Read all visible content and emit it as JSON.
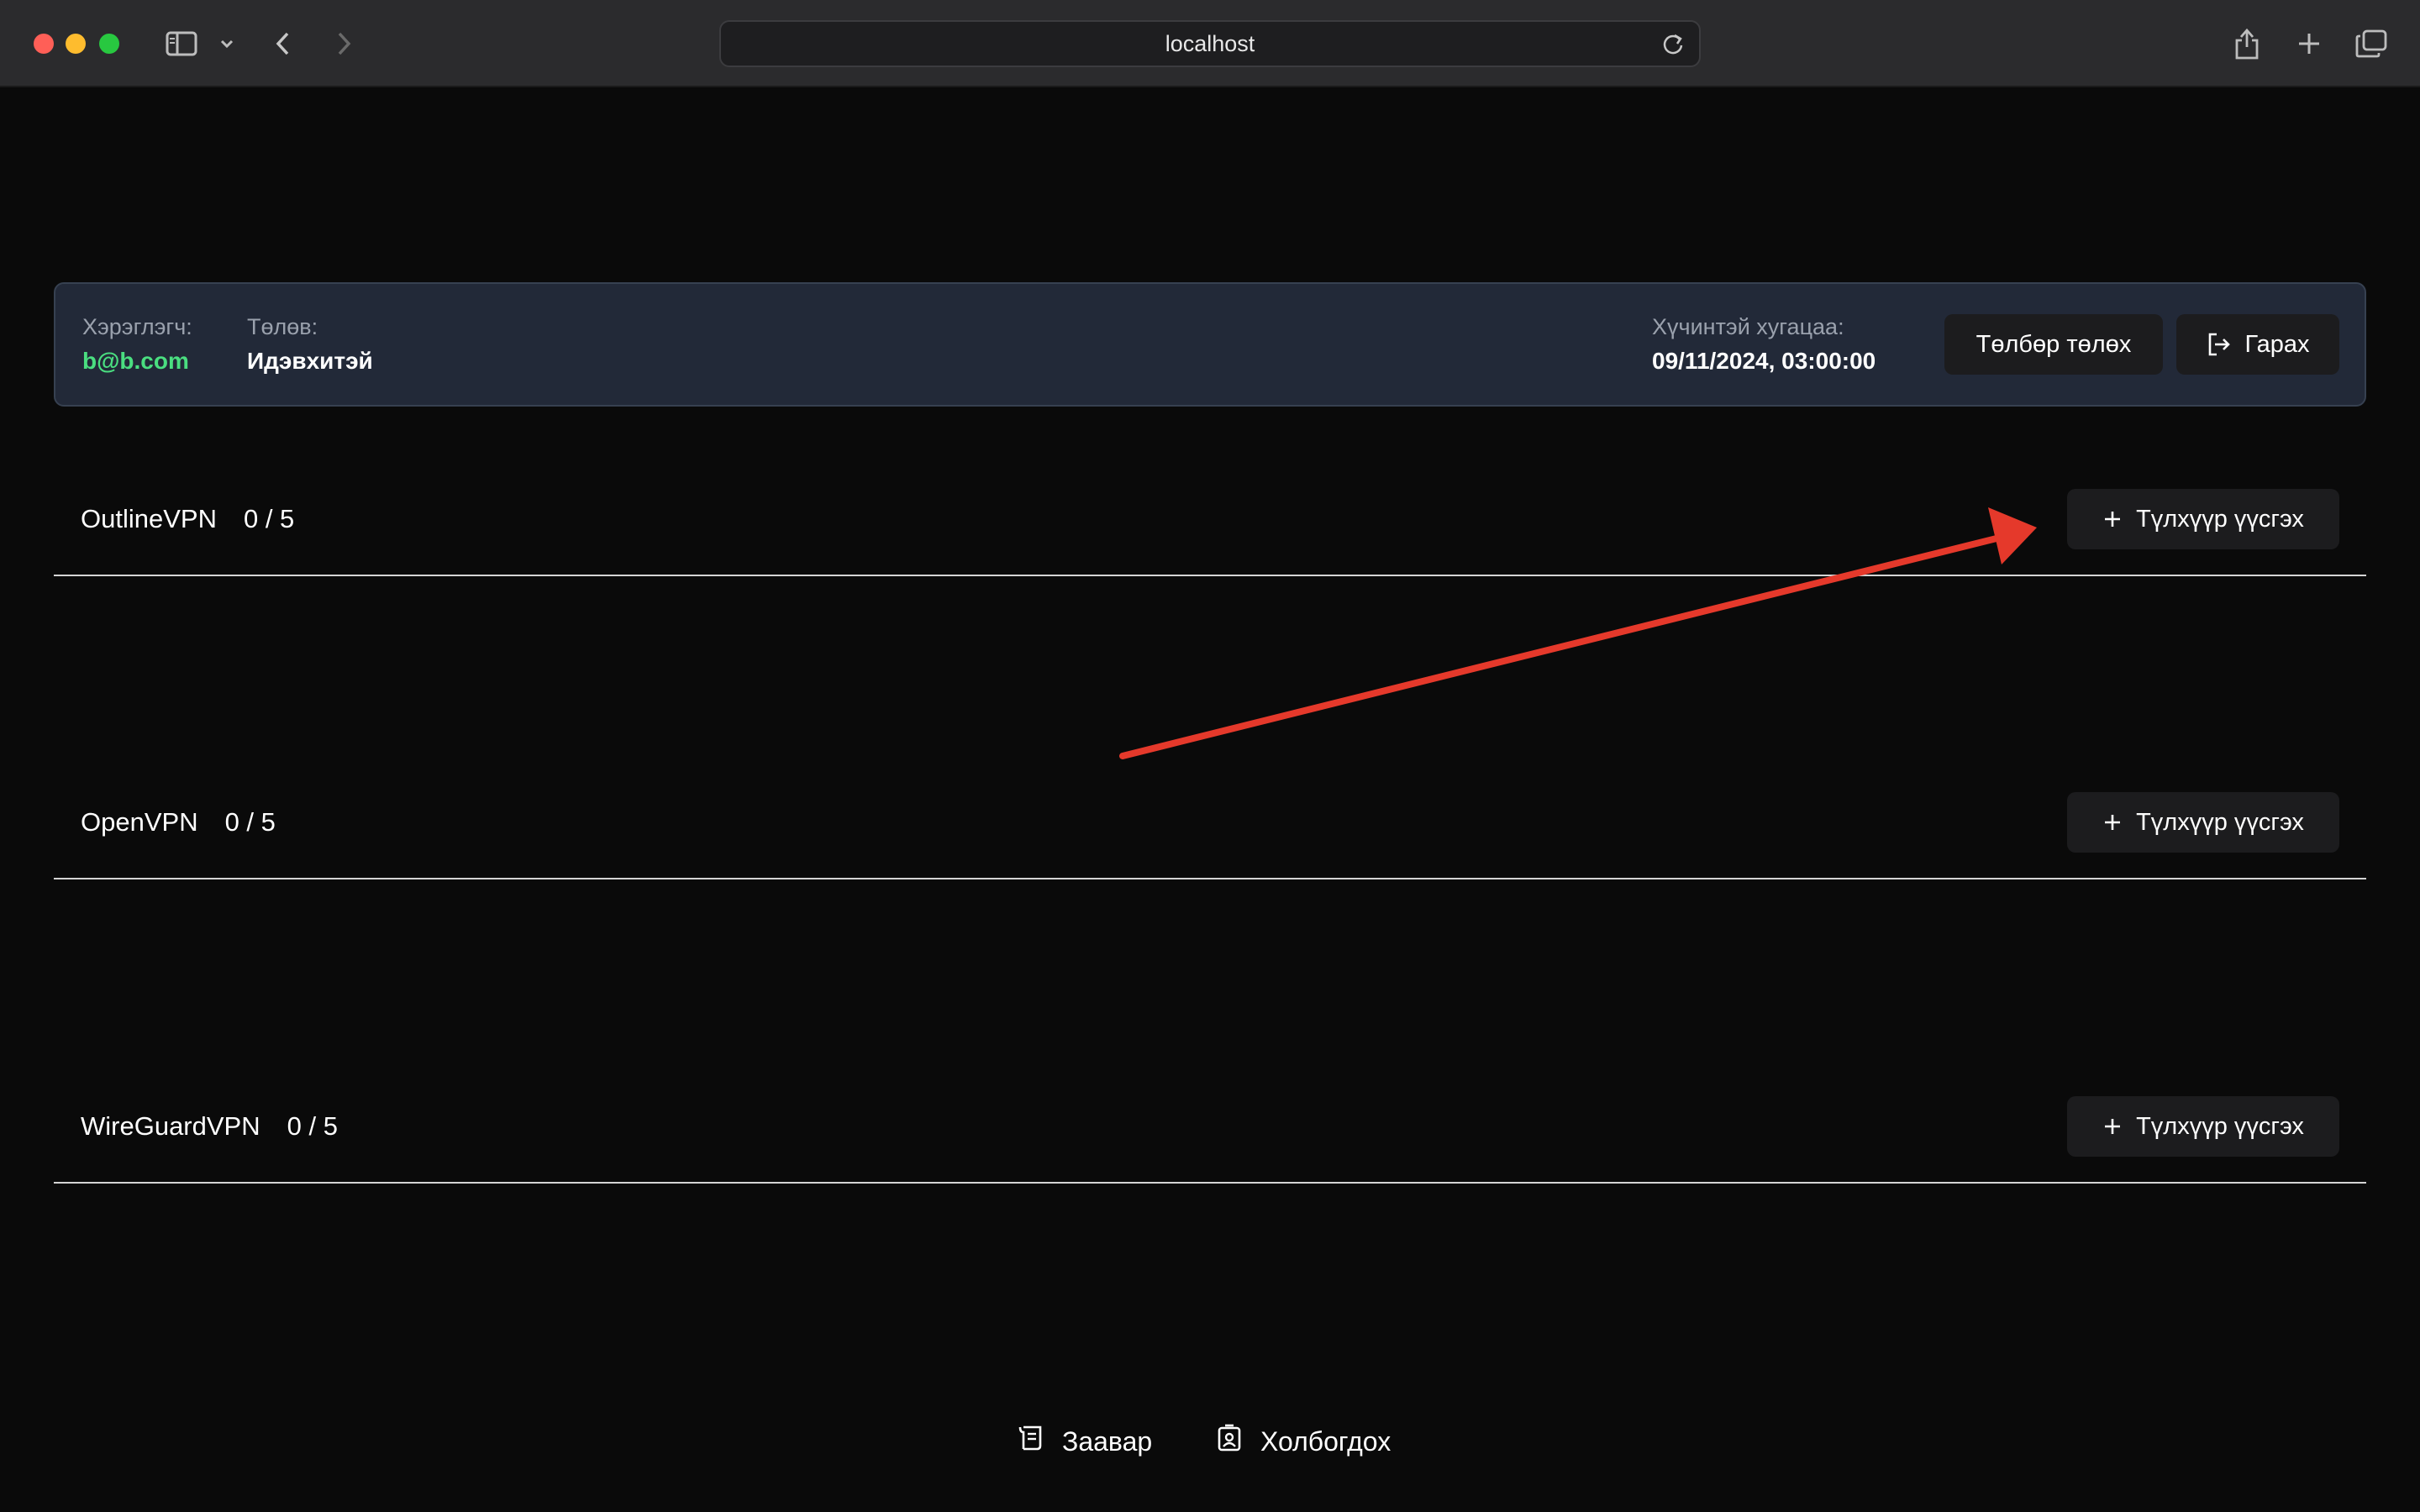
{
  "browser": {
    "url": "localhost",
    "icons": {
      "sidebar": "sidebar-icon",
      "sidebar_menu": "chevron-down-icon",
      "back": "chevron-left-icon",
      "forward": "chevron-right-icon",
      "reload": "reload-icon",
      "share": "share-icon",
      "new_tab": "plus-icon",
      "tabs": "tabs-overview-icon"
    }
  },
  "account": {
    "user_label": "Хэрэглэгч:",
    "user_value": "b@b.com",
    "status_label": "Төлөв:",
    "status_value": "Идэвхитэй",
    "expiry_label": "Хүчинтэй хугацаа:",
    "expiry_value": "09/11/2024, 03:00:00",
    "pay_button": "Төлбөр төлөх",
    "logout_button": "Гарах"
  },
  "vpns": [
    {
      "name": "OutlineVPN",
      "count": "0 / 5",
      "button": "Түлхүүр үүсгэх"
    },
    {
      "name": "OpenVPN",
      "count": "0 / 5",
      "button": "Түлхүүр үүсгэх"
    },
    {
      "name": "WireGuardVPN",
      "count": "0 / 5",
      "button": "Түлхүүр үүсгэх"
    }
  ],
  "footer": {
    "guide": "Заавар",
    "contact": "Холбогдох"
  },
  "colors": {
    "background": "#0a0a0a",
    "card": "#222938",
    "accent_green": "#4ade80",
    "annotation_arrow": "#e5392b"
  }
}
